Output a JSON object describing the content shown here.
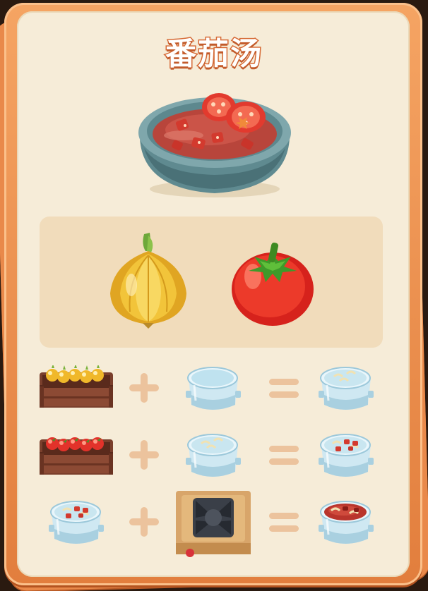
{
  "recipe": {
    "title": "番茄汤",
    "result_icon": "tomato-soup-bowl"
  },
  "ingredients": [
    {
      "name": "onion",
      "icon": "onion-icon"
    },
    {
      "name": "tomato",
      "icon": "tomato-icon"
    }
  ],
  "steps": [
    {
      "inputs": [
        "onion-crate-icon",
        "empty-pot-icon"
      ],
      "output": "onion-water-pot-icon"
    },
    {
      "inputs": [
        "tomato-crate-icon",
        "onion-water-pot-icon"
      ],
      "output": "onion-tomato-pot-icon"
    },
    {
      "inputs": [
        "onion-tomato-pot-icon",
        "stove-icon"
      ],
      "output": "tomato-soup-pot-icon"
    }
  ],
  "colors": {
    "frame": "#e27e3d",
    "card": "#f6ecd8",
    "panel": "#f1dcbb",
    "title_stroke": "#d66a35",
    "operator": "#ecc39d"
  }
}
